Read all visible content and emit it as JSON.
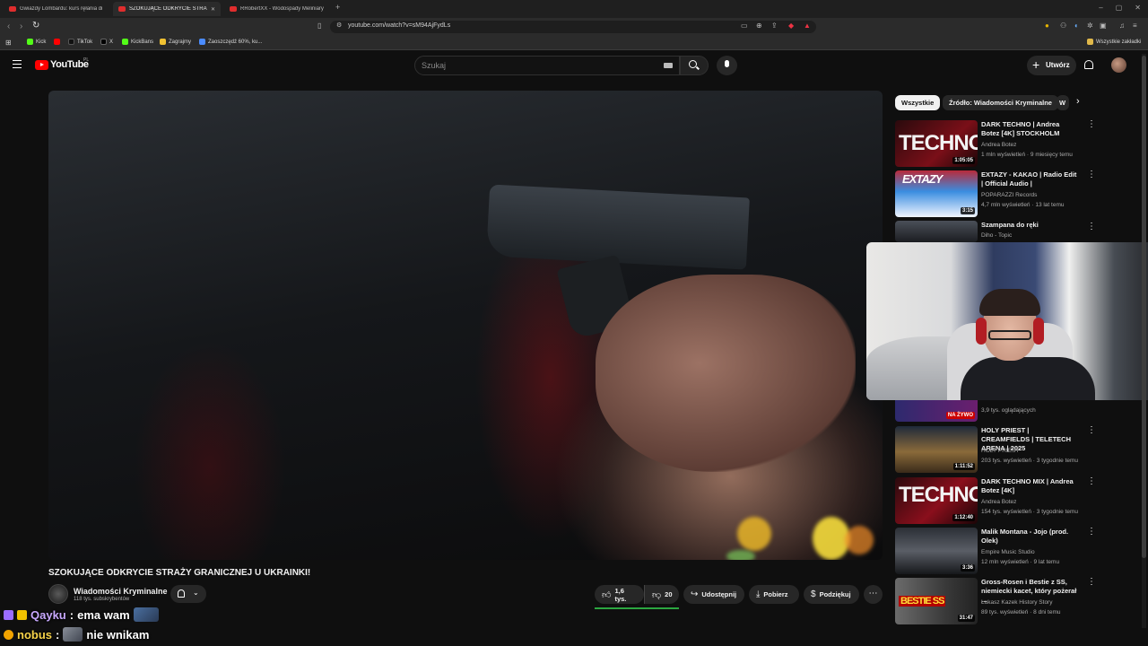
{
  "browser": {
    "tabs": [
      {
        "label": "Gwiazdy Lombardu: kurs ręłania drv",
        "active": false
      },
      {
        "label": "SZOKUJĄCE ODKRYCIE STRA...",
        "active": true
      },
      {
        "label": "RRobertXX - Wodospady Meliniary",
        "active": false
      }
    ],
    "new_tab": "+",
    "url": "youtube.com/watch?v=sM94AjFydLs",
    "bookmarks": [
      "Kick",
      "TikTok",
      "X",
      "KickBans",
      "Zagrajmy",
      "Zaoszczędź 60%, ku..."
    ],
    "bookmarks_folder": "Wszystkie zakładki"
  },
  "youtube": {
    "logo_text": "YouTube",
    "region": "PL",
    "search_placeholder": "Szukaj",
    "create_label": "Utwórz"
  },
  "video": {
    "title": "SZOKUJĄCE ODKRYCIE STRAŻY GRANICZNEJ U UKRAINKI!",
    "channel": "Wiadomości Kryminalne",
    "subscribers": "118 tys. subskrybentów",
    "likes": "1,6 tys.",
    "dislikes": "20",
    "share_label": "Udostępnij",
    "download_label": "Pobierz",
    "thanks_label": "Podziękuj"
  },
  "sidebar": {
    "chips": [
      "Wszystkie",
      "Źródło: Wiadomości Kryminalne",
      "W"
    ],
    "items": [
      {
        "title": "DARK TECHNO | Andrea Botez [4K] STOCKHOLM",
        "channel": "Andrea Botez",
        "meta": "1 mln wyświetleń · 9 miesięcy temu",
        "duration": "1:05:05",
        "thumb_text": "TECHNO"
      },
      {
        "title": "EXTAZY - KAKAO | Radio Edit | Official Audio |",
        "channel": "POPARAZZI Records",
        "meta": "4,7 mln wyświetleń · 13 lat temu",
        "duration": "3:15",
        "thumb_text": "EXTAZY"
      },
      {
        "title": "Szampana do ręki",
        "channel": "Diho - Topic",
        "meta": "",
        "duration": "",
        "thumb_text": ""
      },
      {
        "title": "",
        "channel": "",
        "meta": "3,9 tys. oglądających",
        "duration": "",
        "thumb_text": "",
        "live_badge": "NA ŻYWO"
      },
      {
        "title": "HOLY PRIEST | CREAMFIELDS | TELETECH ARENA | 2025",
        "channel": "HOLY PRIEST",
        "meta": "203 tys. wyświetleń · 3 tygodnie temu",
        "duration": "1:11:52",
        "thumb_text": ""
      },
      {
        "title": "DARK TECHNO MIX | Andrea Botez [4K]",
        "channel": "Andrea Botez",
        "meta": "154 tys. wyświetleń · 3 tygodnie temu",
        "duration": "1:12:40",
        "thumb_text": "TECHNO"
      },
      {
        "title": "Malik Montana - Jojo (prod. Olek)",
        "channel": "Empire Music Studio",
        "meta": "12 mln wyświetleń · 9 lat temu",
        "duration": "3:36",
        "thumb_text": ""
      },
      {
        "title": "Gross-Rosen i Bestie z SS, niemiecki kacet, który pożerał ...",
        "channel": "Łukasz Kazek History Story",
        "meta": "89 tys. wyświetleń · 8 dni temu",
        "duration": "31:47",
        "thumb_text": "BESTIE SS"
      }
    ]
  },
  "chat": [
    {
      "user": "Qayku",
      "message": "ema wam"
    },
    {
      "user": "nobus",
      "message": "nie wnikam"
    }
  ],
  "colors": {
    "accent": "#ff0000",
    "like_bar": "#2ba640",
    "chat_user_1": "#c8a9ff",
    "chat_user_2": "#f7d34a"
  }
}
